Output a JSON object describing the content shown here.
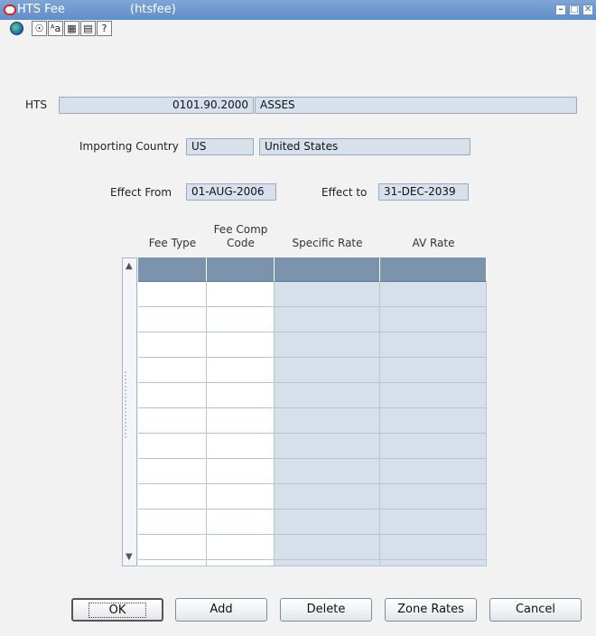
{
  "window": {
    "title": "HTS Fee",
    "form_name": "(htsfee)",
    "controls": {
      "minimize": "–",
      "maximize": "□",
      "close": "✕"
    }
  },
  "toolbar": {
    "icons": [
      "globe-icon",
      "help-circle-icon",
      "font-aa-icon",
      "calendar-icon",
      "notes-icon",
      "question-icon"
    ],
    "glyphs": [
      "",
      "☉",
      "ᴬa",
      "▦",
      "▤",
      "?"
    ]
  },
  "form": {
    "hts_label": "HTS",
    "hts_code": "0101.90.2000",
    "hts_desc": "ASSES",
    "importing_country_label": "Importing Country",
    "country_code": "US",
    "country_name": "United States",
    "effect_from_label": "Effect From",
    "effect_from_value": "01-AUG-2006",
    "effect_to_label": "Effect to",
    "effect_to_value": "31-DEC-2039"
  },
  "table": {
    "columns": [
      "Fee Type",
      "Fee Comp\nCode",
      "Specific Rate",
      "AV Rate"
    ],
    "row_count": 12
  },
  "buttons": {
    "ok": "OK",
    "add": "Add",
    "delete": "Delete",
    "zone_rates": "Zone Rates",
    "cancel": "Cancel"
  },
  "colors": {
    "titlebar": "#6b97cf",
    "header_row": "#7b93ad",
    "readonly_cell": "#d6e0eb"
  }
}
